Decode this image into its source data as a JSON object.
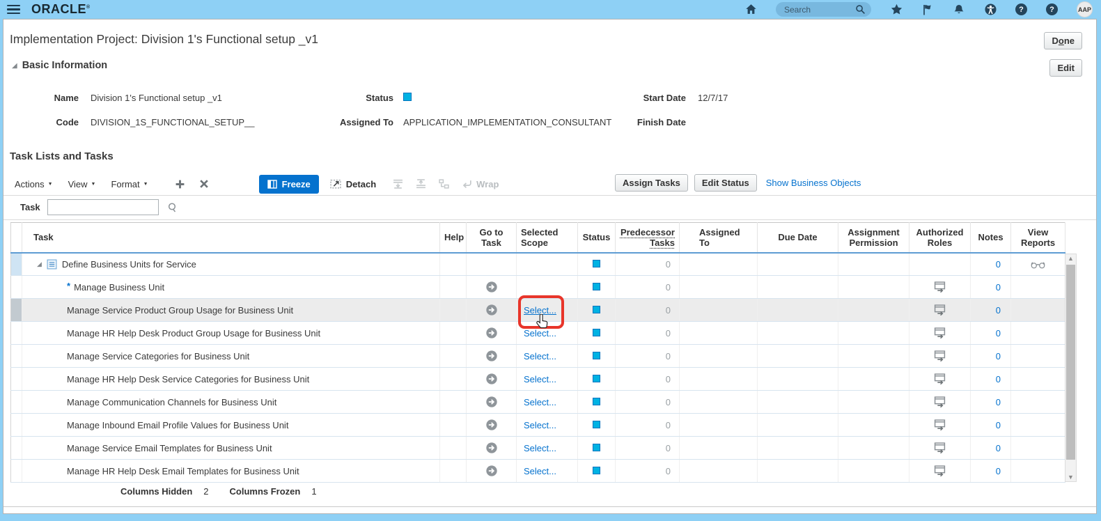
{
  "topbar": {
    "brand": "ORACLE",
    "search_placeholder": "Search",
    "avatar": "AAP"
  },
  "page": {
    "title": "Implementation Project: Division 1's Functional setup _v1",
    "done_button": {
      "pre": "D",
      "key": "o",
      "post": "ne"
    },
    "edit_button": "Edit"
  },
  "basic_info": {
    "section_title": "Basic Information",
    "name_label": "Name",
    "name_value": "Division 1's Functional setup _v1",
    "code_label": "Code",
    "code_value": "DIVISION_1S_FUNCTIONAL_SETUP__",
    "status_label": "Status",
    "assigned_to_label": "Assigned To",
    "assigned_to_value": "APPLICATION_IMPLEMENTATION_CONSULTANT",
    "start_date_label": "Start Date",
    "start_date_value": "12/7/17",
    "finish_date_label": "Finish Date",
    "finish_date_value": ""
  },
  "tasks_section": {
    "title": "Task Lists and Tasks",
    "toolbar": {
      "actions": "Actions",
      "view": "View",
      "format": "Format",
      "freeze": "Freeze",
      "detach": "Detach",
      "wrap": "Wrap",
      "assign_tasks": "Assign Tasks",
      "edit_status": "Edit Status",
      "show_business_objects": "Show Business Objects"
    },
    "filter": {
      "label": "Task",
      "value": ""
    },
    "table": {
      "headers": {
        "task": "Task",
        "help": "Help",
        "goto": "Go to Task",
        "scope": "Selected Scope",
        "status": "Status",
        "predecessor": "Predecessor Tasks",
        "assigned": "Assigned To",
        "due": "Due Date",
        "permission": "Assignment Permission",
        "roles": "Authorized Roles",
        "notes": "Notes",
        "reports": "View Reports"
      },
      "rows": [
        {
          "label": "Define Business Units for Service",
          "parent": true,
          "required": false,
          "goto": false,
          "scope": null,
          "status": true,
          "predecessor": "0",
          "assigned_to": "",
          "due_date": "",
          "assignment_permission": "",
          "authorized_roles_icon": false,
          "notes": "0",
          "view_reports_icon": true,
          "highlighted": false,
          "annotated": false
        },
        {
          "label": "Manage Business Unit",
          "parent": false,
          "required": true,
          "goto": true,
          "scope": null,
          "status": true,
          "predecessor": "0",
          "assigned_to": "",
          "due_date": "",
          "assignment_permission": "",
          "authorized_roles_icon": true,
          "notes": "0",
          "view_reports_icon": false,
          "highlighted": false,
          "annotated": false
        },
        {
          "label": "Manage Service Product Group Usage for Business Unit",
          "parent": false,
          "required": false,
          "goto": true,
          "scope": "Select...",
          "status": true,
          "predecessor": "0",
          "assigned_to": "",
          "due_date": "",
          "assignment_permission": "",
          "authorized_roles_icon": true,
          "notes": "0",
          "view_reports_icon": false,
          "highlighted": true,
          "annotated": true
        },
        {
          "label": "Manage HR Help Desk Product Group Usage for Business Unit",
          "parent": false,
          "required": false,
          "goto": true,
          "scope": "Select...",
          "status": true,
          "predecessor": "0",
          "assigned_to": "",
          "due_date": "",
          "assignment_permission": "",
          "authorized_roles_icon": true,
          "notes": "0",
          "view_reports_icon": false,
          "highlighted": false,
          "annotated": false
        },
        {
          "label": "Manage Service Categories for Business Unit",
          "parent": false,
          "required": false,
          "goto": true,
          "scope": "Select...",
          "status": true,
          "predecessor": "0",
          "assigned_to": "",
          "due_date": "",
          "assignment_permission": "",
          "authorized_roles_icon": true,
          "notes": "0",
          "view_reports_icon": false,
          "highlighted": false,
          "annotated": false
        },
        {
          "label": "Manage HR Help Desk Service Categories for Business Unit",
          "parent": false,
          "required": false,
          "goto": true,
          "scope": "Select...",
          "status": true,
          "predecessor": "0",
          "assigned_to": "",
          "due_date": "",
          "assignment_permission": "",
          "authorized_roles_icon": true,
          "notes": "0",
          "view_reports_icon": false,
          "highlighted": false,
          "annotated": false
        },
        {
          "label": "Manage Communication Channels for Business Unit",
          "parent": false,
          "required": false,
          "goto": true,
          "scope": "Select...",
          "status": true,
          "predecessor": "0",
          "assigned_to": "",
          "due_date": "",
          "assignment_permission": "",
          "authorized_roles_icon": true,
          "notes": "0",
          "view_reports_icon": false,
          "highlighted": false,
          "annotated": false
        },
        {
          "label": "Manage Inbound Email Profile Values for Business Unit",
          "parent": false,
          "required": false,
          "goto": true,
          "scope": "Select...",
          "status": true,
          "predecessor": "0",
          "assigned_to": "",
          "due_date": "",
          "assignment_permission": "",
          "authorized_roles_icon": true,
          "notes": "0",
          "view_reports_icon": false,
          "highlighted": false,
          "annotated": false
        },
        {
          "label": "Manage Service Email Templates for Business Unit",
          "parent": false,
          "required": false,
          "goto": true,
          "scope": "Select...",
          "status": true,
          "predecessor": "0",
          "assigned_to": "",
          "due_date": "",
          "assignment_permission": "",
          "authorized_roles_icon": true,
          "notes": "0",
          "view_reports_icon": false,
          "highlighted": false,
          "annotated": false
        },
        {
          "label": "Manage HR Help Desk Email Templates for Business Unit",
          "parent": false,
          "required": false,
          "goto": true,
          "scope": "Select...",
          "status": true,
          "predecessor": "0",
          "assigned_to": "",
          "due_date": "",
          "assignment_permission": "",
          "authorized_roles_icon": true,
          "notes": "0",
          "view_reports_icon": false,
          "highlighted": false,
          "annotated": false
        }
      ]
    },
    "footer": {
      "columns_hidden_label": "Columns Hidden",
      "columns_hidden_value": "2",
      "columns_frozen_label": "Columns Frozen",
      "columns_frozen_value": "1"
    }
  },
  "colors": {
    "topbar": "#8ed0f5",
    "accent_blue": "#0572ce",
    "link_blue": "#0572ce",
    "status_fill": "#00b2e3",
    "annotation_red": "#e8352a"
  }
}
